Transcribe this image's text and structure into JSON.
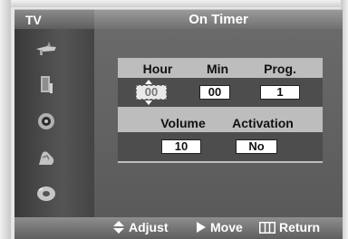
{
  "menu": {
    "section": "TV",
    "title": "On Timer"
  },
  "sidebar": {
    "items": [
      {
        "icon": "antenna-icon"
      },
      {
        "icon": "picture-icon"
      },
      {
        "icon": "sound-disc-icon"
      },
      {
        "icon": "channel-hand-icon"
      },
      {
        "icon": "setup-tape-icon"
      }
    ]
  },
  "timer": {
    "hour_label": "Hour",
    "min_label": "Min",
    "prog_label": "Prog.",
    "hour_value": "00",
    "min_value": "00",
    "prog_value": "1",
    "volume_label": "Volume",
    "activation_label": "Activation",
    "volume_value": "10",
    "activation_value": "No"
  },
  "footer": {
    "adjust_label": "Adjust",
    "move_label": "Move",
    "return_label": "Return"
  }
}
